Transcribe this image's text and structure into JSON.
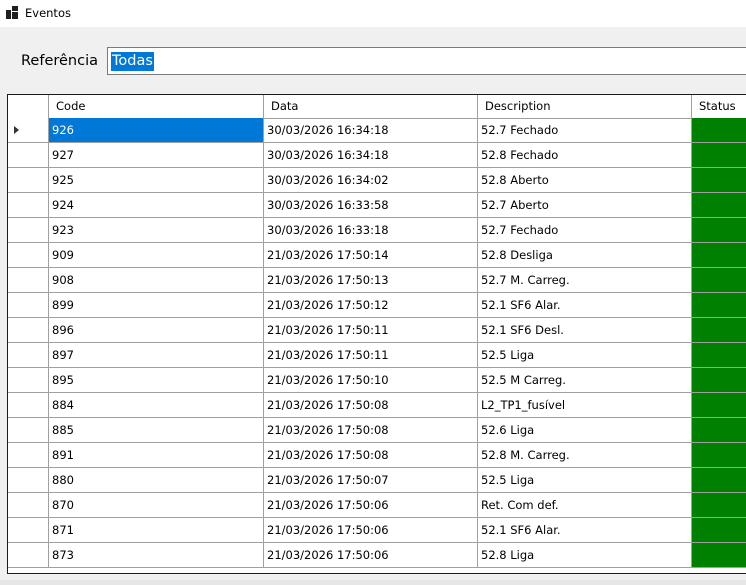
{
  "window": {
    "title": "Eventos",
    "icon": "app-grid-icon"
  },
  "filter": {
    "label": "Referência",
    "value": "Todas"
  },
  "grid": {
    "columns": [
      "Code",
      "Data",
      "Description",
      "Status"
    ],
    "current_row_index": 0,
    "rows": [
      {
        "code": "926",
        "data": "30/03/2026 16:34:18",
        "description": "52.7 Fechado"
      },
      {
        "code": "927",
        "data": "30/03/2026 16:34:18",
        "description": "52.8 Fechado"
      },
      {
        "code": "925",
        "data": "30/03/2026 16:34:02",
        "description": "52.8 Aberto"
      },
      {
        "code": "924",
        "data": "30/03/2026 16:33:58",
        "description": "52.7 Aberto"
      },
      {
        "code": "923",
        "data": "30/03/2026 16:33:18",
        "description": "52.7 Fechado"
      },
      {
        "code": "909",
        "data": "21/03/2026 17:50:14",
        "description": "52.8 Desliga"
      },
      {
        "code": "908",
        "data": "21/03/2026 17:50:13",
        "description": "52.7 M. Carreg."
      },
      {
        "code": "899",
        "data": "21/03/2026 17:50:12",
        "description": "52.1 SF6 Alar."
      },
      {
        "code": "896",
        "data": "21/03/2026 17:50:11",
        "description": "52.1 SF6 Desl."
      },
      {
        "code": "897",
        "data": "21/03/2026 17:50:11",
        "description": "52.5 Liga"
      },
      {
        "code": "895",
        "data": "21/03/2026 17:50:10",
        "description": "52.5 M Carreg."
      },
      {
        "code": "884",
        "data": "21/03/2026 17:50:08",
        "description": "L2_TP1_fusível"
      },
      {
        "code": "885",
        "data": "21/03/2026 17:50:08",
        "description": "52.6 Liga"
      },
      {
        "code": "891",
        "data": "21/03/2026 17:50:08",
        "description": "52.8 M. Carreg."
      },
      {
        "code": "880",
        "data": "21/03/2026 17:50:07",
        "description": "52.5 Liga"
      },
      {
        "code": "870",
        "data": "21/03/2026 17:50:06",
        "description": "Ret. Com def."
      },
      {
        "code": "871",
        "data": "21/03/2026 17:50:06",
        "description": "52.1 SF6 Alar."
      },
      {
        "code": "873",
        "data": "21/03/2026 17:50:06",
        "description": "52.8 Liga"
      }
    ],
    "status_color": "#008000",
    "selection_color": "#0078d7"
  }
}
